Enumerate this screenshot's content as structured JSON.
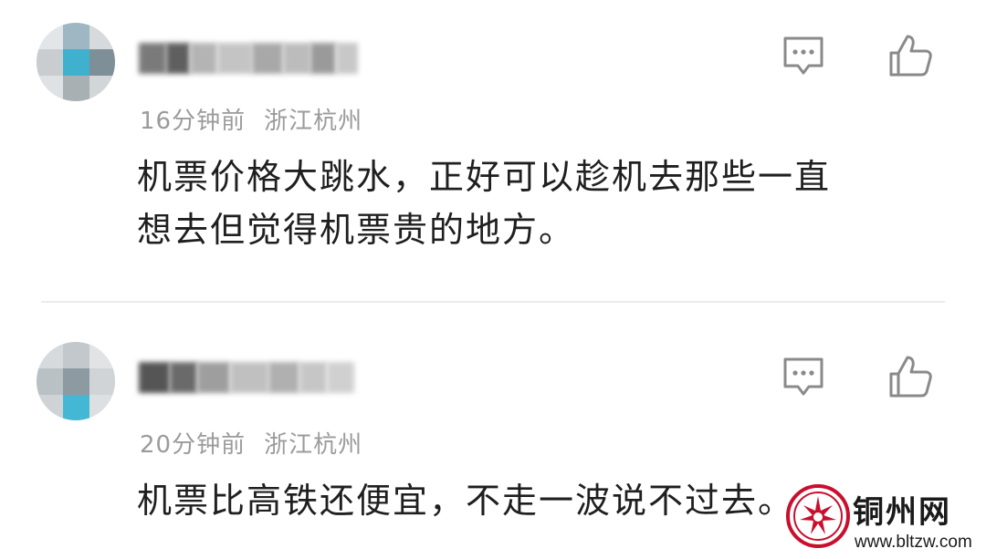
{
  "comments": [
    {
      "time": "16分钟前",
      "location": "浙江杭州",
      "text_line1": "机票价格大跳水，正好可以趁机去那些一直",
      "text_line2": "想去但觉得机票贵的地方。"
    },
    {
      "time": "20分钟前",
      "location": "浙江杭州",
      "text_line1": "机票比高铁还便宜，不走一波说不过去。",
      "text_line2": ""
    }
  ],
  "icons": {
    "comment": "comment-bubble-icon",
    "like": "thumbs-up-icon"
  },
  "watermark": {
    "title": "铜州网",
    "url": "www.bltzw.com"
  },
  "colors": {
    "meta_text": "#9b9b9b",
    "content_text": "#1f1f1f",
    "icon_stroke": "#8a8a8a",
    "divider": "#ebebeb"
  }
}
